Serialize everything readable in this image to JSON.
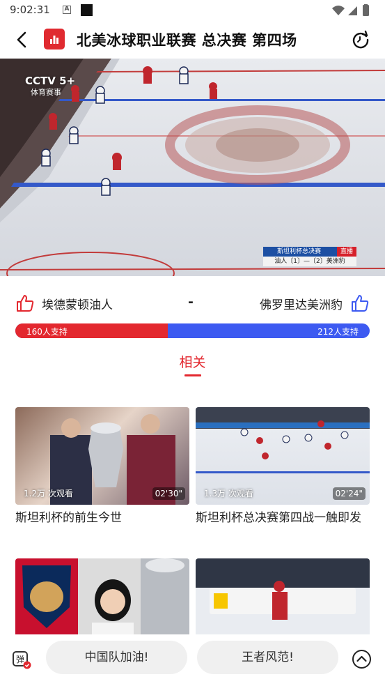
{
  "status_bar": {
    "time": "9:02:31",
    "a_icon_label": "A"
  },
  "header": {
    "title": "北美冰球职业联赛 总决赛 第四场"
  },
  "video": {
    "channel": "CCTV 5+",
    "channel_sub": "体育赛事",
    "score_title": "斯坦利杯总决赛",
    "score_live": "直播",
    "score_line": "油人〔1〕—〔2〕美洲豹"
  },
  "vote": {
    "team_left": "埃德蒙顿油人",
    "separator": "-",
    "team_right": "佛罗里达美洲豹",
    "left_support": "160人支持",
    "right_support": "212人支持",
    "left_count": 160,
    "right_count": 212,
    "left_color": "#e3282f",
    "right_color": "#3d5af1"
  },
  "related": {
    "tab_label": "相关"
  },
  "cards": [
    {
      "views": "1.2万 次观看",
      "duration": "02'30\"",
      "title": "斯坦利杯的前生今世"
    },
    {
      "views": "1.3万 次观看",
      "duration": "02'24\"",
      "title": "斯坦利杯总决赛第四战一触即发"
    },
    {
      "views": "",
      "duration": "",
      "title": ""
    },
    {
      "views": "",
      "duration": "",
      "title": ""
    }
  ],
  "comments": {
    "chip_1": "中国队加油!",
    "chip_2": "王者风范!"
  },
  "icons": {
    "back": "back-arrow-icon",
    "logo": "app-logo-icon",
    "refresh": "refresh-icon",
    "thumb_up": "thumb-up-icon",
    "danmu": "danmu-icon",
    "scroll_up": "scroll-up-icon"
  }
}
